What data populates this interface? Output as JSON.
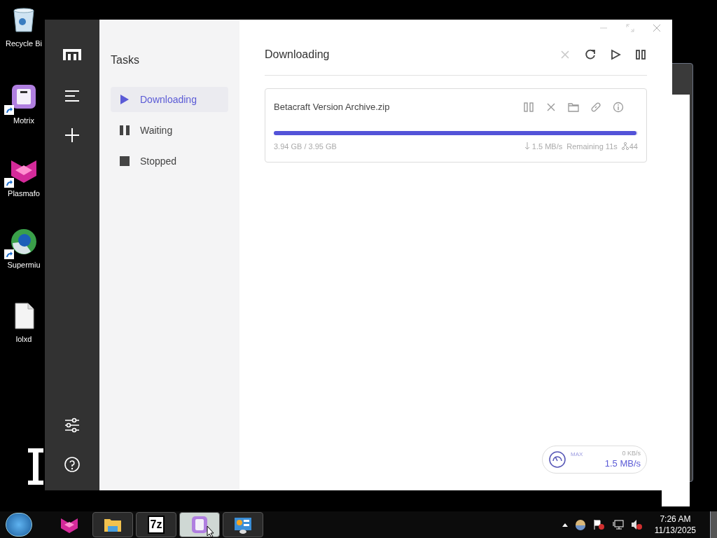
{
  "desktop_icons": [
    {
      "label": "Recycle Bi",
      "kind": "bin",
      "shortcut": false
    },
    {
      "label": "Motrix",
      "kind": "motrix",
      "shortcut": true
    },
    {
      "label": "Plasmafo",
      "kind": "plasma",
      "shortcut": true
    },
    {
      "label": "Supermiu",
      "kind": "globe",
      "shortcut": true
    },
    {
      "label": "lolxd",
      "kind": "file",
      "shortcut": false
    }
  ],
  "app": {
    "sidebar": [
      {
        "kind": "logo"
      },
      {
        "kind": "menu"
      },
      {
        "kind": "add"
      }
    ],
    "sidebar_bottom": [
      {
        "kind": "settings"
      },
      {
        "kind": "help"
      }
    ],
    "tasks_title": "Tasks",
    "task_lists": [
      {
        "label": "Downloading",
        "kind": "play",
        "selected": true
      },
      {
        "label": "Waiting",
        "kind": "pause",
        "selected": false
      },
      {
        "label": "Stopped",
        "kind": "stop",
        "selected": false
      }
    ],
    "title": "Downloading",
    "toolbar": [
      {
        "kind": "close",
        "disabled": true
      },
      {
        "kind": "refresh",
        "disabled": false
      },
      {
        "kind": "play",
        "disabled": false
      },
      {
        "kind": "pause",
        "disabled": false
      }
    ],
    "tasks": [
      {
        "name": "Betacraft Version Archive.zip",
        "level": 0.997,
        "size": "3.94 GB / 3.95 GB",
        "speed": "1.5 MB/s",
        "remaining": "Remaining 11s",
        "connections": "44"
      }
    ],
    "speed": {
      "label": "MAX",
      "upload": "0 KB/s",
      "download": "1.5 MB/s"
    }
  },
  "taskbar": {
    "items": [
      {
        "kind": "plasma",
        "selected": false,
        "framed": false
      },
      {
        "kind": "folder",
        "selected": false,
        "framed": true
      },
      {
        "kind": "sevenzip",
        "label": "7z",
        "selected": false,
        "framed": true
      },
      {
        "kind": "motrix",
        "selected": true,
        "framed": true
      },
      {
        "kind": "panel",
        "selected": false,
        "framed": true
      }
    ],
    "time": "7:26 AM",
    "date": "11/13/2025"
  }
}
